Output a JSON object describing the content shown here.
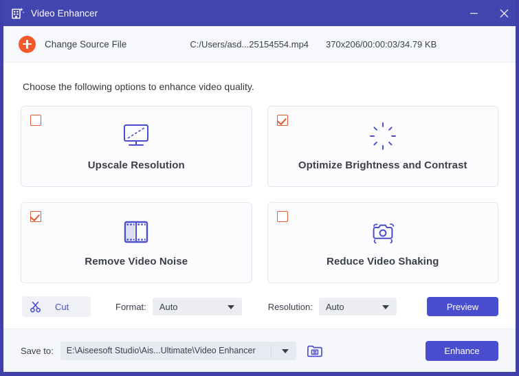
{
  "window": {
    "title": "Video Enhancer",
    "app_icon": "video-enhancer-icon",
    "minimize_label": "minimize-icon",
    "close_label": "close-icon"
  },
  "source_bar": {
    "add_icon": "plus-circle-icon",
    "change_source_label": "Change Source File",
    "file_path": "C:/Users/asd...25154554.mp4",
    "file_meta": "370x206/00:00:03/34.79 KB"
  },
  "main": {
    "instruction": "Choose the following options to enhance video quality.",
    "options": [
      {
        "id": "upscale-resolution",
        "label": "Upscale Resolution",
        "checked": false,
        "icon": "monitor-icon"
      },
      {
        "id": "optimize-brightness-contrast",
        "label": "Optimize Brightness and Contrast",
        "checked": true,
        "icon": "brightness-sun-icon"
      },
      {
        "id": "remove-video-noise",
        "label": "Remove Video Noise",
        "checked": true,
        "icon": "film-strip-icon"
      },
      {
        "id": "reduce-video-shaking",
        "label": "Reduce Video Shaking",
        "checked": false,
        "icon": "camera-stabilize-icon"
      }
    ]
  },
  "controls": {
    "cut_label": "Cut",
    "cut_icon": "scissors-icon",
    "format_label": "Format:",
    "format_value": "Auto",
    "resolution_label": "Resolution:",
    "resolution_value": "Auto",
    "preview_label": "Preview"
  },
  "bottom": {
    "save_to_label": "Save to:",
    "save_to_path": "E:\\Aiseesoft Studio\\Ais...Ultimate\\Video Enhancer",
    "folder_icon": "folder-open-icon",
    "enhance_label": "Enhance"
  },
  "colors": {
    "titlebar": "#4245ad",
    "window_border": "#3f41a8",
    "accent_purple": "#4a4ece",
    "accent_orange": "#f4592b",
    "checkbox_orange": "#e0592f",
    "bottom_bar": "#f6f7fb",
    "source_bar": "#f7f8fc"
  }
}
